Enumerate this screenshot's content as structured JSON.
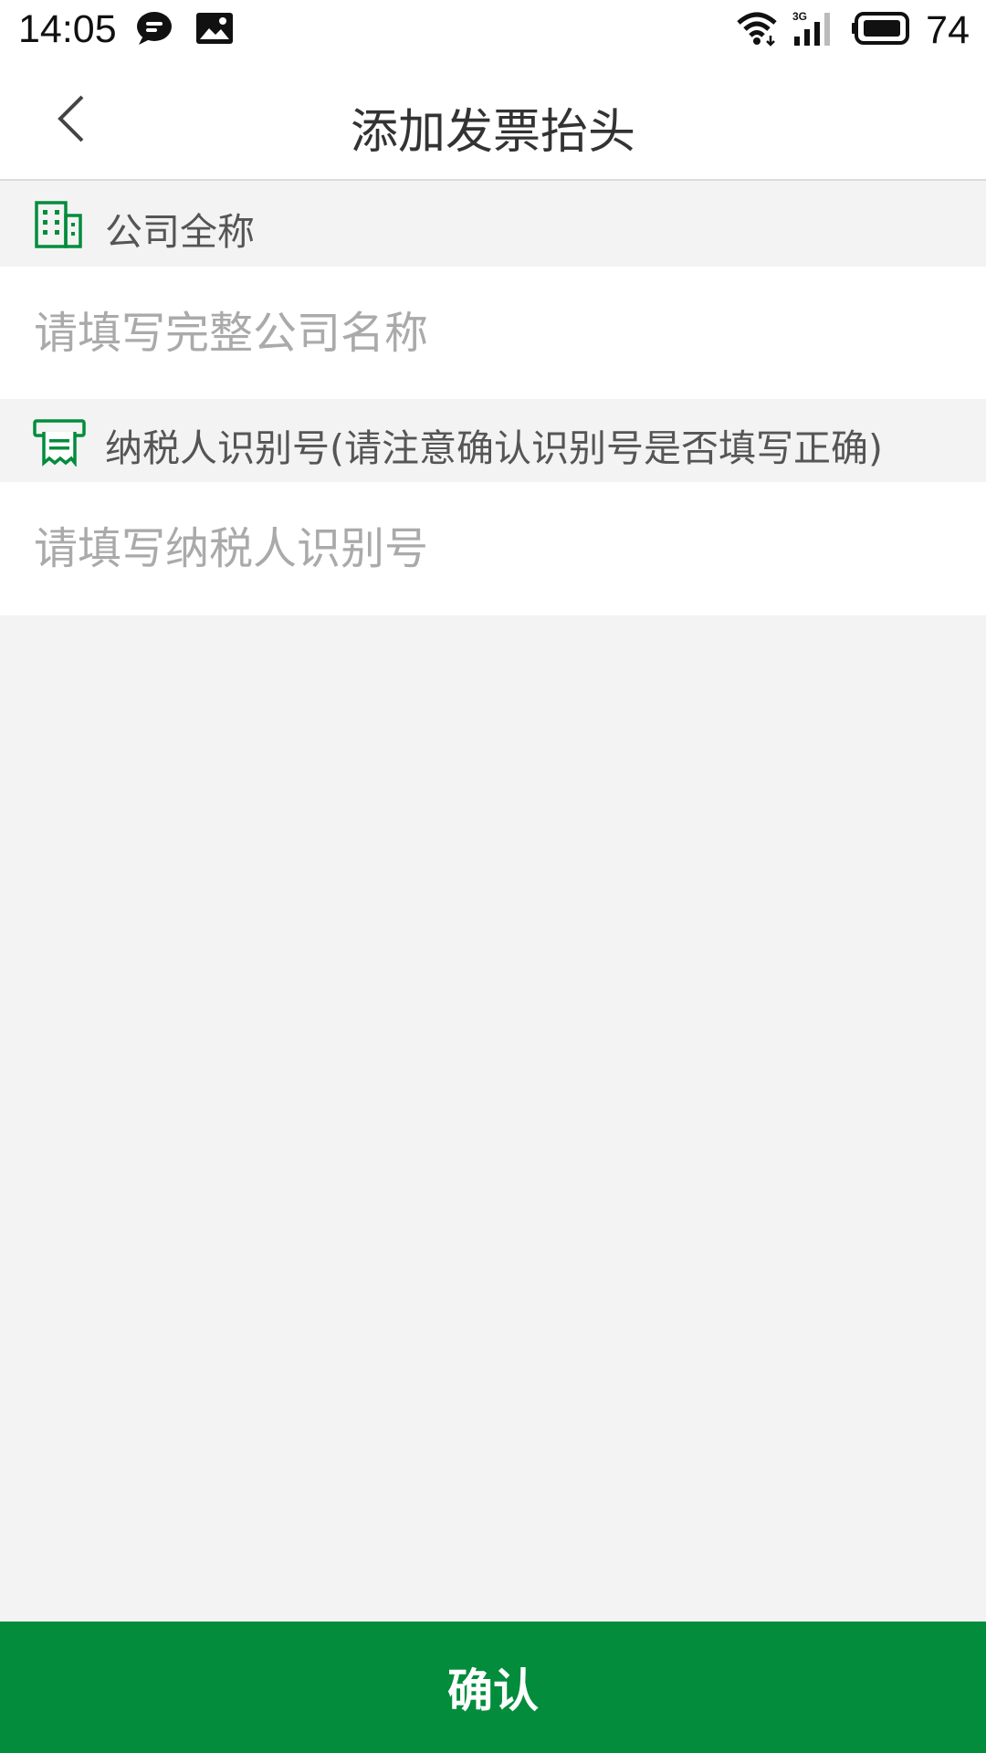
{
  "status_bar": {
    "time": "14:05",
    "battery_level": "74",
    "network_type": "3G",
    "icons": [
      "chat-bubble-icon",
      "image-notification-icon",
      "wifi-icon",
      "cellular-signal-icon",
      "battery-icon"
    ]
  },
  "app_bar": {
    "title": "添加发票抬头",
    "back_icon": "chevron-left-icon"
  },
  "form": {
    "company": {
      "label": "公司全称",
      "icon": "building-icon",
      "placeholder": "请填写完整公司名称",
      "value": ""
    },
    "tax_id": {
      "label": "纳税人识别号(请注意确认识别号是否填写正确)",
      "icon": "receipt-icon",
      "placeholder": "请填写纳税人识别号",
      "value": ""
    }
  },
  "confirm_button": {
    "label": "确认"
  },
  "colors": {
    "accent": "#028c3c",
    "background": "#f3f3f3",
    "placeholder": "#aaaaaa"
  }
}
